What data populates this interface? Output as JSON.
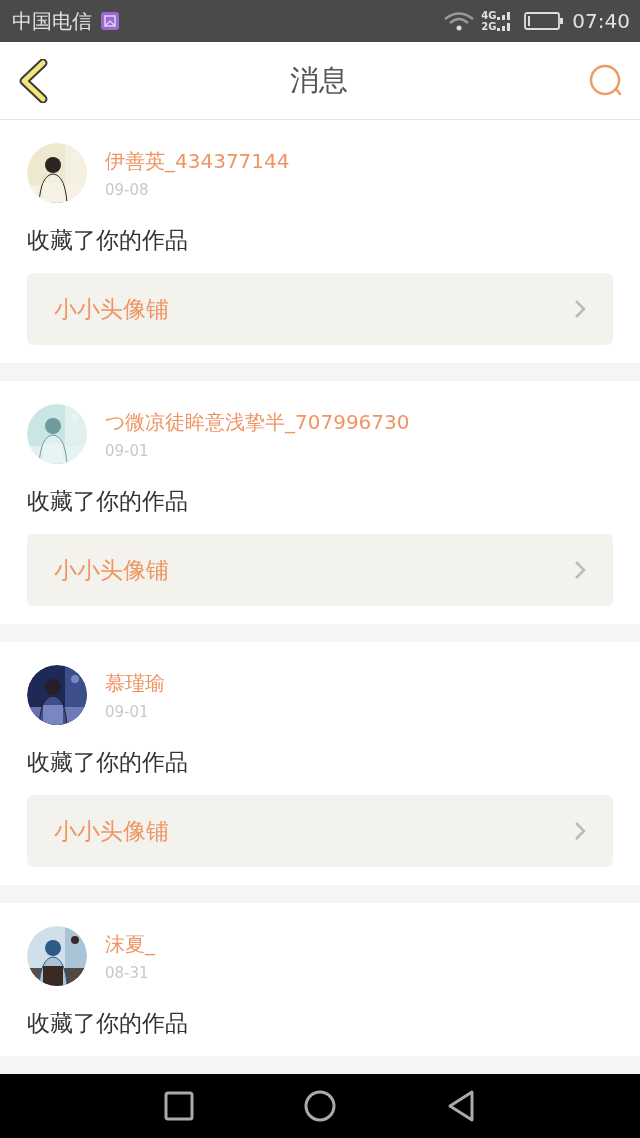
{
  "status_bar": {
    "carrier": "中国电信",
    "network_top": "4G",
    "network_bottom": "2G",
    "time": "07:40"
  },
  "header": {
    "title": "消息"
  },
  "messages": [
    {
      "user": "伊善英_434377144",
      "date": "09-08",
      "action": "收藏了你的作品",
      "link": "小小头像铺"
    },
    {
      "user": "つ微凉徒眸意浅挚半_707996730",
      "date": "09-01",
      "action": "收藏了你的作品",
      "link": "小小头像铺"
    },
    {
      "user": "慕瑾瑜",
      "date": "09-01",
      "action": "收藏了你的作品",
      "link": "小小头像铺"
    },
    {
      "user": "沫夏_",
      "date": "08-31",
      "action": "收藏了你的作品"
    }
  ]
}
